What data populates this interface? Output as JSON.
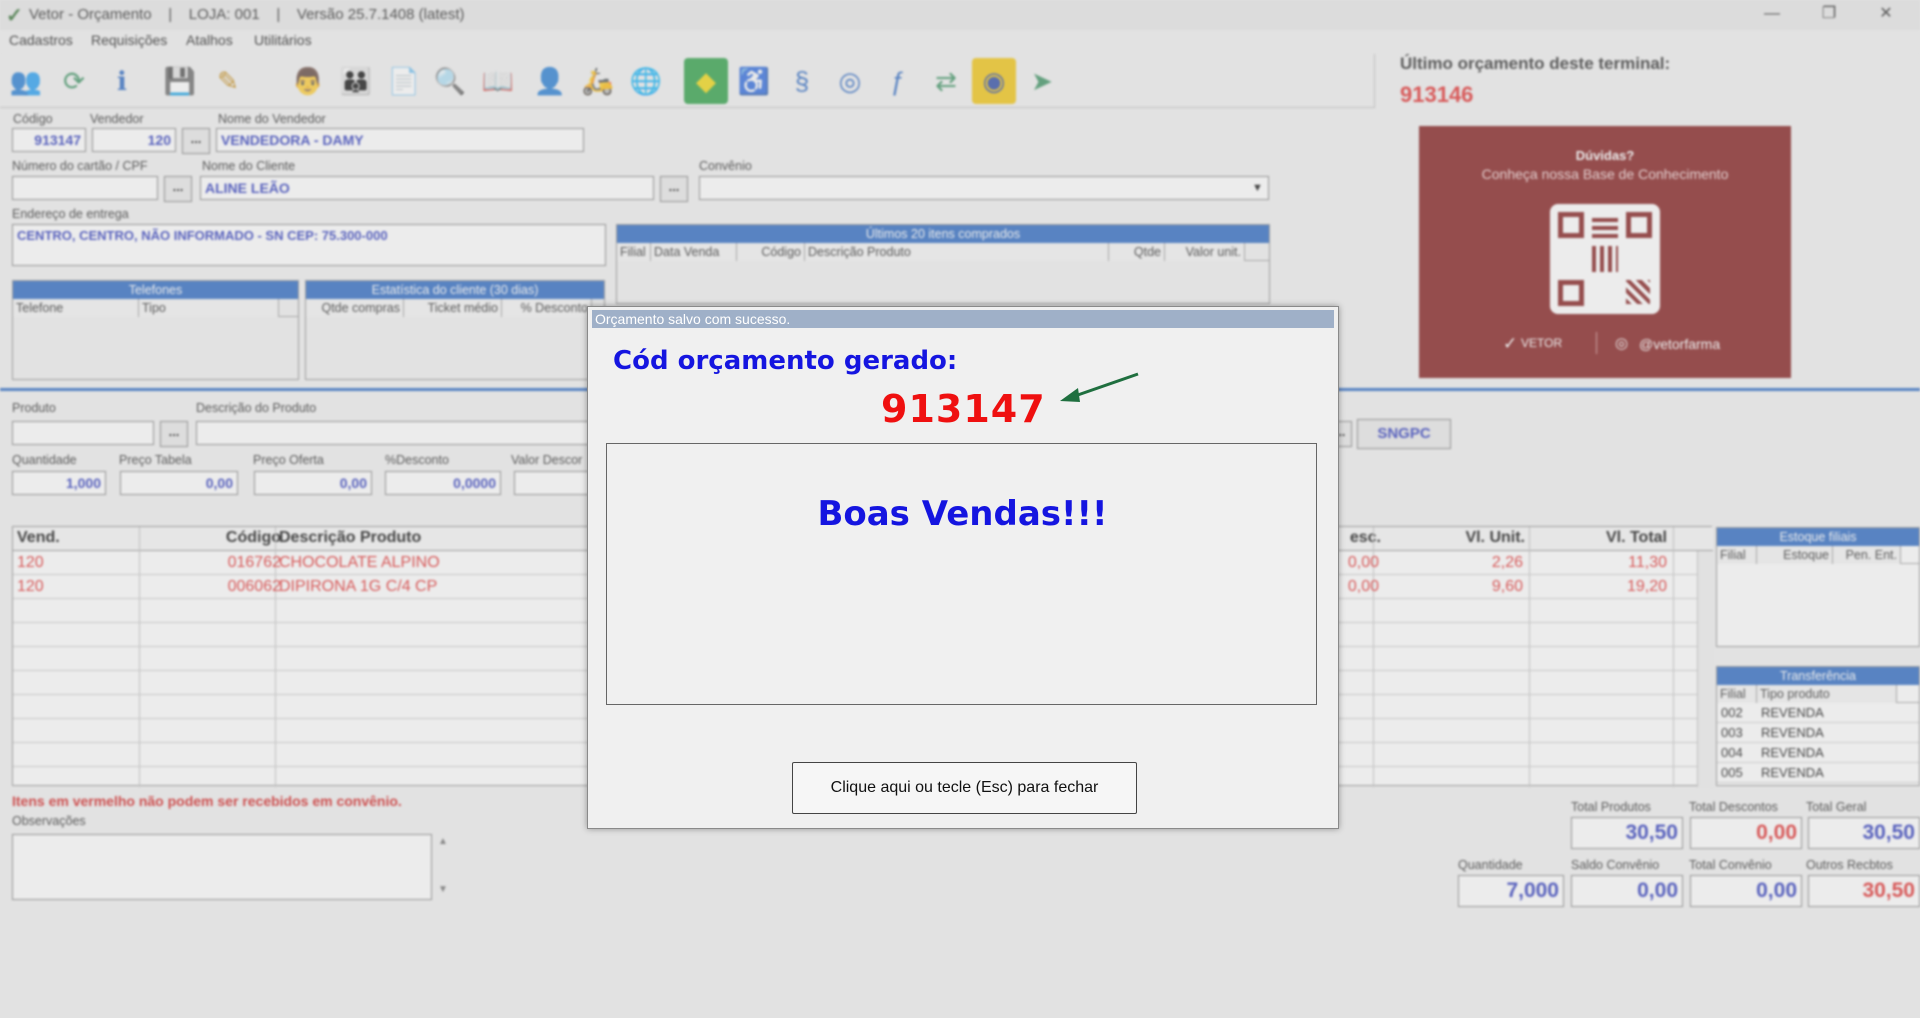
{
  "window": {
    "title": "Vetor - Orçamento    |    LOJA: 001    |    Versão 25.7.1408 (latest)",
    "minimize_glyph": "—",
    "maximize_glyph": "❐",
    "close_glyph": "✕"
  },
  "menu": [
    "Cadastros",
    "Requisições",
    "Atalhos",
    "Utilitários"
  ],
  "toolbar_icons": [
    {
      "name": "add-user-icon",
      "glyph": "👥",
      "color": "#6b8e23"
    },
    {
      "name": "sync-icon",
      "glyph": "⟳",
      "color": "#2e8b57"
    },
    {
      "name": "info-icon",
      "glyph": "ℹ",
      "color": "#1e5fbf"
    },
    {
      "name": "save-icon",
      "glyph": "💾",
      "color": "#444"
    },
    {
      "name": "pencil-icon",
      "glyph": "✎",
      "color": "#c08000"
    },
    {
      "name": "people-icon",
      "glyph": "👨",
      "color": "#b07040"
    },
    {
      "name": "customers-icon",
      "glyph": "👪",
      "color": "#b07040"
    },
    {
      "name": "documents-icon",
      "glyph": "📄",
      "color": "#888"
    },
    {
      "name": "search-icon",
      "glyph": "🔍",
      "color": "#1e5fbf"
    },
    {
      "name": "book-icon",
      "glyph": "📖",
      "color": "#3060a0"
    },
    {
      "name": "user-icon",
      "glyph": "👤",
      "color": "#555"
    },
    {
      "name": "delivery-icon",
      "glyph": "🛵",
      "color": "#c02020"
    },
    {
      "name": "globe-icon",
      "glyph": "🌐",
      "color": "#333"
    },
    {
      "name": "brazil-flag-icon",
      "glyph": "◆",
      "color": "#f2d600"
    },
    {
      "name": "accessibility-icon",
      "glyph": "♿",
      "color": "#1e5fbf"
    },
    {
      "name": "dna-icon",
      "glyph": "§",
      "color": "#1e5fbf"
    },
    {
      "name": "spiral-icon",
      "glyph": "◎",
      "color": "#1e5fbf"
    },
    {
      "name": "f-logo-icon",
      "glyph": "ƒ",
      "color": "#1e5fbf"
    },
    {
      "name": "refresh-arrows-icon",
      "glyph": "⇄",
      "color": "#2e8b57"
    },
    {
      "name": "ring-icon",
      "glyph": "◉",
      "color": "#1f3f9f"
    },
    {
      "name": "arrow-logo-icon",
      "glyph": "➤",
      "color": "#2e8b57"
    }
  ],
  "form": {
    "codigo_label": "Código",
    "codigo": "913147",
    "vendedor_label": "Vendedor",
    "vendedor": "120",
    "nome_vendedor_label": "Nome do Vendedor",
    "nome_vendedor": "VENDEDORA - DAMY",
    "cartao_label": "Número do cartão / CPF",
    "cartao": "",
    "cliente_label": "Nome do Cliente",
    "cliente": "ALINE LEÃO",
    "convenio_label": "Convênio",
    "convenio": "",
    "endereco_label": "Endereço de entrega",
    "endereco": "CENTRO, CENTRO, NÃO INFORMADO - SN CEP: 75.300-000",
    "ellipsis": "..."
  },
  "telefones": {
    "title": "Telefones",
    "cols": [
      "Telefone",
      "Tipo"
    ]
  },
  "estatistica": {
    "title": "Estatística do cliente (30 dias)",
    "cols": [
      "Qtde compras",
      "Ticket médio",
      "% Desconto"
    ]
  },
  "ultimos": {
    "title": "Últimos 20 itens comprados",
    "cols": [
      "Filial",
      "Data Venda",
      "Código",
      "Descrição Produto",
      "Qtde",
      "Valor unit."
    ]
  },
  "ultimo_orcamento": {
    "label": "Último orçamento deste terminal:",
    "value": "913146"
  },
  "banner": {
    "title": "Dúvidas?",
    "subtitle": "Conheça nossa Base de Conhecimento",
    "brand": "VETOR",
    "handle": "@vetorfarma"
  },
  "produto": {
    "produto_label": "Produto",
    "descricao_label": "Descrição do Produto",
    "quantidade_label": "Quantidade",
    "quantidade": "1,000",
    "preco_tabela_label": "Preço Tabela",
    "preco_tabela": "0,00",
    "preco_oferta_label": "Preço Oferta",
    "preco_oferta": "0,00",
    "desconto_label": "%Desconto",
    "desconto": "0,0000",
    "valor_desc_label": "Valor Descor",
    "sngpc_button": "SNGPC"
  },
  "items_grid": {
    "cols": [
      "Vend.",
      "Código",
      "Descrição Produto",
      "esc.",
      "Vl. Unit.",
      "Vl. Total"
    ],
    "rows": [
      {
        "vend": "120",
        "codigo": "016762",
        "descricao": "CHOCOLATE ALPINO",
        "desc": "0,00",
        "vl_unit": "2,26",
        "vl_total": "11,30"
      },
      {
        "vend": "120",
        "codigo": "006062",
        "descricao": "DIPIRONA  1G C/4 CP",
        "desc": "0,00",
        "vl_unit": "9,60",
        "vl_total": "19,20"
      }
    ]
  },
  "aviso": "Itens em vermelho não podem ser recebidos em convênio.",
  "observacoes_label": "Observações",
  "estoque_filiais": {
    "title": "Estoque filiais",
    "cols": [
      "Filial",
      "Estoque",
      "Pen. Ent."
    ]
  },
  "transferencia": {
    "title": "Transferência",
    "cols": [
      "Filial",
      "Tipo produto"
    ],
    "rows": [
      {
        "filial": "002",
        "tipo": "REVENDA"
      },
      {
        "filial": "003",
        "tipo": "REVENDA"
      },
      {
        "filial": "004",
        "tipo": "REVENDA"
      },
      {
        "filial": "005",
        "tipo": "REVENDA"
      }
    ]
  },
  "totais": {
    "total_produtos_label": "Total Produtos",
    "total_produtos": "30,50",
    "total_descontos_label": "Total Descontos",
    "total_descontos": "0,00",
    "total_geral_label": "Total Geral",
    "total_geral": "30,50",
    "quantidade_label": "Quantidade",
    "quantidade": "7,000",
    "saldo_convenio_label": "Saldo Convênio",
    "saldo_convenio": "0,00",
    "total_convenio_label": "Total Convênio",
    "total_convenio": "0,00",
    "outros_recbtos_label": "Outros Recbtos",
    "outros_recbtos": "30,50"
  },
  "dialog": {
    "title": "Orçamento salvo com sucesso.",
    "label": "Cód orçamento gerado:",
    "code": "913147",
    "message": "Boas Vendas!!!",
    "close_button": "Clique aqui ou tecle (Esc) para fechar"
  },
  "colors": {
    "accent_blue": "#1d5fbf",
    "value_blue": "#1f2db8",
    "alert_red": "#e02020",
    "banner_red": "#7a0c0c"
  }
}
